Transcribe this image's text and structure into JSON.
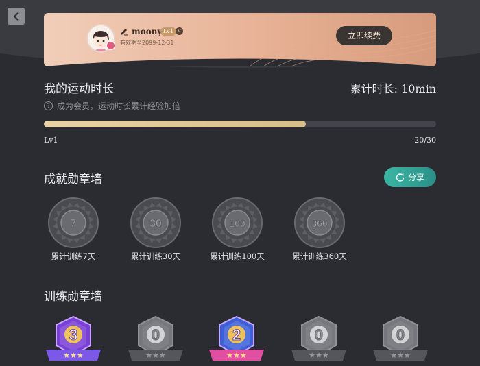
{
  "header": {
    "username": "moony",
    "level_tag": "LV1",
    "v_tag": "V",
    "validity": "有效期至2099-12-31",
    "renew_label": "立即续费"
  },
  "exercise": {
    "title": "我的运动时长",
    "total_label": "累计时长: 10min",
    "tip": "成为会员，运动时长累计经验加倍",
    "level_label": "Lv1",
    "progress_text": "20/30",
    "progress_fraction": 0.667
  },
  "achievements": {
    "title": "成就勋章墙",
    "share_label": "分享",
    "items": [
      {
        "number": "7",
        "label": "累计训练7天"
      },
      {
        "number": "30",
        "label": "累计训练30天"
      },
      {
        "number": "100",
        "label": "累计训练100天"
      },
      {
        "number": "360",
        "label": "累计训练360天"
      }
    ]
  },
  "training": {
    "title": "训练勋章墙",
    "items": [
      {
        "number": "3",
        "active": true,
        "color": "#7a3fd6",
        "ribbon": "#7b59e6"
      },
      {
        "number": "0",
        "active": false,
        "color": "#77787d",
        "ribbon": "#55565b"
      },
      {
        "number": "2",
        "active": true,
        "color": "#3d5fd8",
        "ribbon": "#e04fa2"
      },
      {
        "number": "0",
        "active": false,
        "color": "#77787d",
        "ribbon": "#55565b"
      },
      {
        "number": "0",
        "active": false,
        "color": "#77787d",
        "ribbon": "#55565b"
      }
    ]
  },
  "colors": {
    "background": "#2b2c32",
    "accent_gold": "#e0c794",
    "share_teal": "#33a99b"
  }
}
